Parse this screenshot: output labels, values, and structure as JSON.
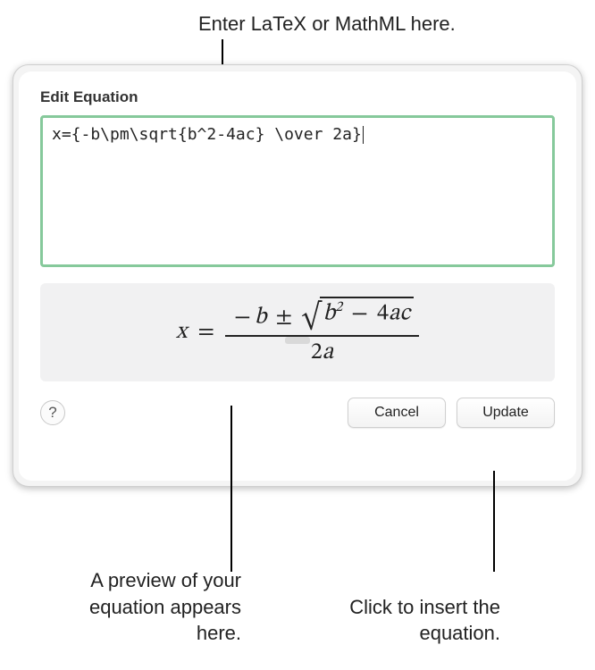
{
  "annotations": {
    "top": "Enter LaTeX or MathML here.",
    "bottom_left": "A preview of your equation appears here.",
    "bottom_right": "Click to insert the equation."
  },
  "dialog": {
    "title": "Edit Equation",
    "editor_value": "x={-b\\pm\\sqrt{b^2-4ac} \\over 2a}",
    "help_label": "?",
    "cancel_label": "Cancel",
    "update_label": "Update"
  },
  "preview": {
    "lhs": "x",
    "eq": "=",
    "num_minus": "−",
    "num_b": "b",
    "pm": "±",
    "rad_b": "b",
    "rad_exp": "2",
    "rad_minus": "−",
    "rad_4": "4",
    "rad_a": "a",
    "rad_c": "c",
    "den_2": "2",
    "den_a": "a"
  }
}
